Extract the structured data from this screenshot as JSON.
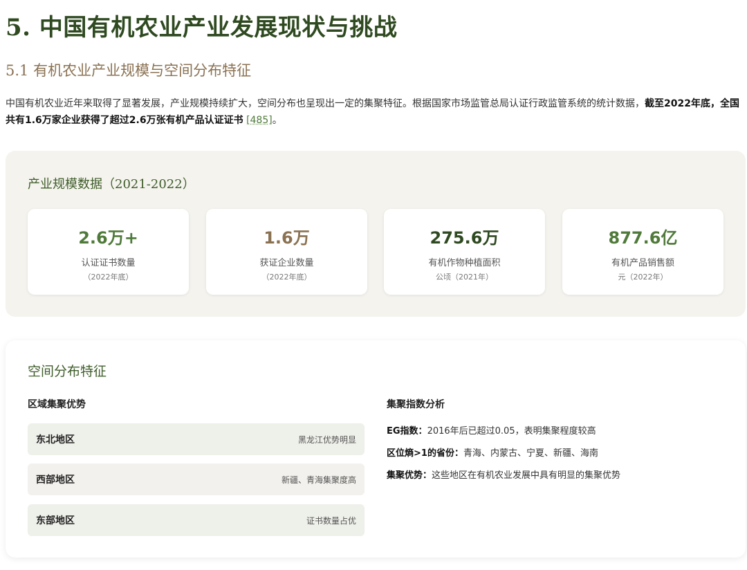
{
  "heading": "5. 中国有机农业产业发展现状与挑战",
  "subheading": "5.1 有机农业产业规模与空间分布特征",
  "intro": {
    "text_plain": "中国有机农业近年来取得了显著发展，产业规模持续扩大，空间分布也呈现出一定的集聚特征。根据国家市场监管总局认证行政监管系统的统计数据，",
    "text_bold": "截至2022年底，全国共有1.6万家企业获得了超过2.6万张有机产品认证证书",
    "ref": "[485]",
    "end": "。"
  },
  "scale_panel": {
    "title": "产业规模数据（2021-2022）",
    "stats": [
      {
        "value": "2.6万+",
        "label": "认证证书数量",
        "note": "（2022年底）",
        "color": "#4f7a3a"
      },
      {
        "value": "1.6万",
        "label": "获证企业数量",
        "note": "（2022年底）",
        "color": "#8a7152"
      },
      {
        "value": "275.6万",
        "label": "有机作物种植面积",
        "note": "公顷（2021年）",
        "color": "#2f4a20"
      },
      {
        "value": "877.6亿",
        "label": "有机产品销售额",
        "note": "元（2022年）",
        "color": "#4f7a3a"
      }
    ]
  },
  "spatial_panel": {
    "title": "空间分布特征",
    "left_title": "区域集聚优势",
    "regions": [
      {
        "name": "东北地区",
        "desc": "黑龙江优势明显",
        "bg": "#eef0ea"
      },
      {
        "name": "西部地区",
        "desc": "新疆、青海集聚度高",
        "bg": "#f2f1ed"
      },
      {
        "name": "东部地区",
        "desc": "证书数量占优",
        "bg": "#eef0ea"
      }
    ],
    "right_title": "集聚指数分析",
    "items": [
      {
        "label": "EG指数：",
        "text": "2016年后已超过0.05，表明集聚程度较高"
      },
      {
        "label": "区位熵>1的省份：",
        "text": "青海、内蒙古、宁夏、新疆、海南"
      },
      {
        "label": "集聚优势：",
        "text": "这些地区在有机农业发展中具有明显的集聚优势"
      }
    ]
  }
}
